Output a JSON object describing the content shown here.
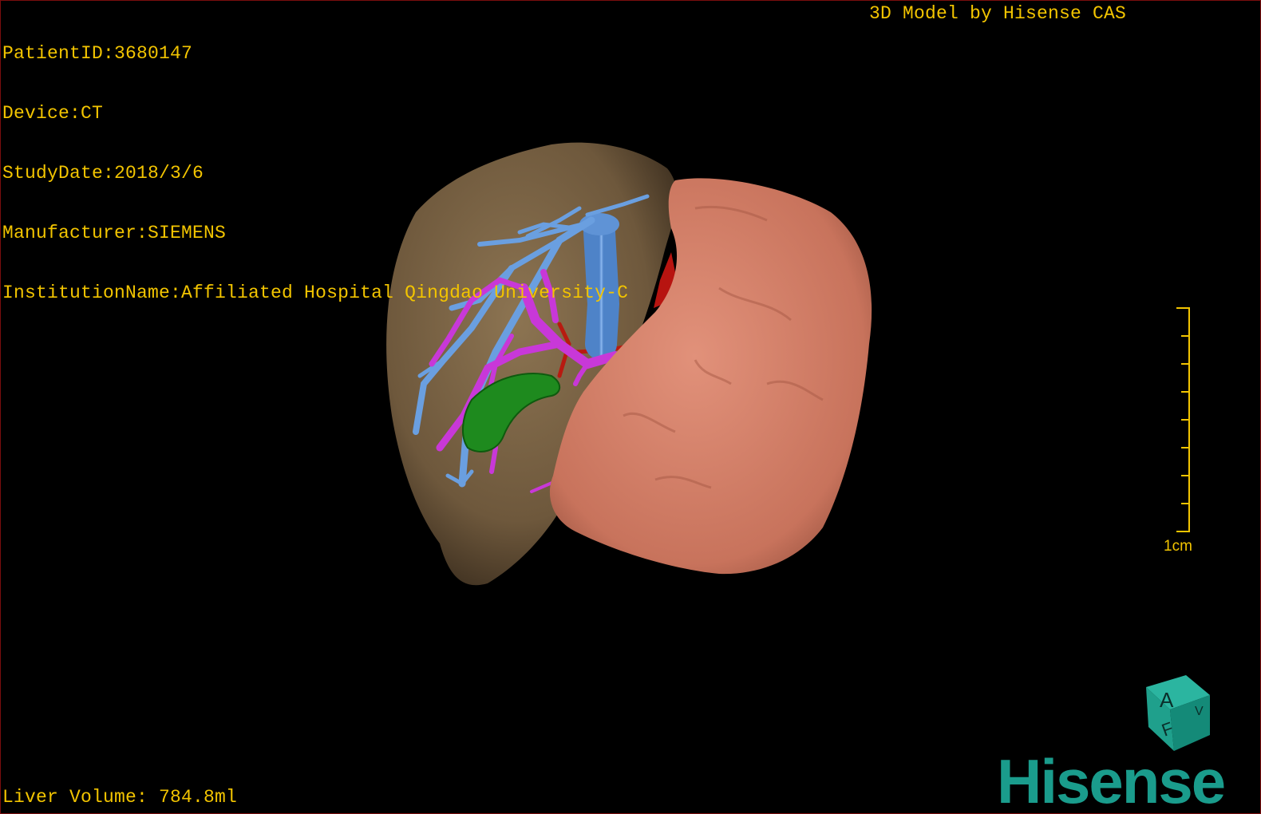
{
  "dicom_info": {
    "patient_id": "PatientID:3680147",
    "device": "Device:CT",
    "study_date": "StudyDate:2018/3/6",
    "manufacturer": "Manufacturer:SIEMENS",
    "institution": "InstitutionName:Affiliated Hospital Qingdao University-C"
  },
  "model_credit": "3D Model by Hisense CAS",
  "liver_volume": "Liver Volume: 784.8ml",
  "scale_bar": {
    "label": "1cm"
  },
  "orientation_cube": {
    "face_front": "A",
    "face_bottom": "F",
    "face_side": "V"
  },
  "brand": "Hisense",
  "colors": {
    "overlay_text": "#f2c400",
    "liver": "#7d6548",
    "tumor": "#d7806a",
    "portal_vein": "#6a9fe0",
    "hepatic_vein": "#c838d8",
    "artery": "#c21b10",
    "gallbladder": "#1a8c1a",
    "brand": "#1a9c8c"
  }
}
